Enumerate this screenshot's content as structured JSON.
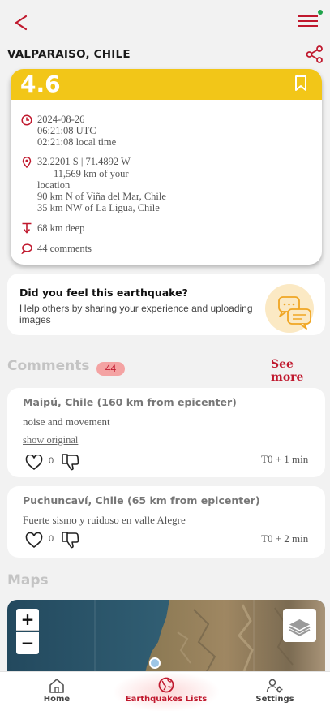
{
  "header": {
    "back_icon": "chevron-left-icon",
    "menu_icon": "hamburger-menu-icon",
    "location_title": "VALPARAISO, CHILE",
    "share_icon": "share-icon"
  },
  "quake": {
    "magnitude": "4.6",
    "date": "2024-08-26",
    "utc_time": "06:21:08 UTC",
    "local_time": "02:21:08 local time",
    "coordinates": "32.2201 S | 71.4892 W",
    "distance_from_you": "11,569 km of your",
    "distance_suffix": "location",
    "near_1": "90 km N of Viña del Mar, Chile",
    "near_2": "35 km NW of La Ligua, Chile",
    "depth": "68 km deep",
    "comments": "44 comments"
  },
  "feel": {
    "title": "Did you feel this earthquake?",
    "description": "Help others by sharing your experience and uploading images"
  },
  "comments_section": {
    "heading": "Comments",
    "count": "44",
    "see_more": "See more"
  },
  "comments": [
    {
      "title": "Maipú, Chile (160 km from epicenter)",
      "body": "noise and movement",
      "show_original": "show original",
      "likes": "0",
      "time": "T0 + 1 min"
    },
    {
      "title": "Puchuncaví, Chile (65 km from epicenter)",
      "body": "Fuerte sismo y ruidoso en valle Alegre",
      "likes": "0",
      "time": "T0 + 2 min"
    }
  ],
  "maps": {
    "heading": "Maps",
    "zoom_in": "+",
    "zoom_out": "−"
  },
  "nav": [
    {
      "label": "Home",
      "icon": "home-icon"
    },
    {
      "label": "Earthquakes Lists",
      "icon": "globe-icon"
    },
    {
      "label": "Settings",
      "icon": "user-settings-icon"
    }
  ],
  "colors": {
    "accent": "#c0192e",
    "magnitude_bar": "#f2c618",
    "badge_bg": "#f4a3a3",
    "online_dot": "#1ea34a"
  }
}
